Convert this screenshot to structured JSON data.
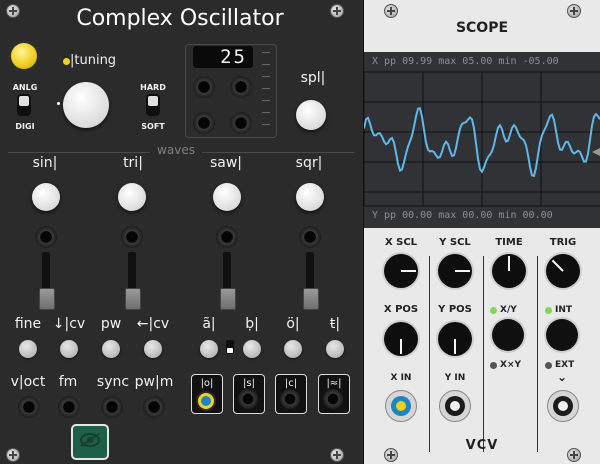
{
  "oscillator": {
    "title": "Complex Oscillator",
    "tuning_label": "|tuning",
    "anlg_label": "ANLG",
    "digi_label": "DIGI",
    "hard_label": "HARD",
    "soft_label": "SOFT",
    "display_value": "25",
    "spl_label": "spl|",
    "waves_label": "waves",
    "wave_knobs": [
      "sin|",
      "tri|",
      "saw|",
      "sqr|"
    ],
    "mod_labels": [
      "fine",
      "↓|cv",
      "pw",
      "←|cv"
    ],
    "glyph_labels": [
      "ã|",
      "ḅ|",
      "ö|",
      "ŧ|"
    ],
    "jack_labels": [
      "v|oct",
      "fm",
      "sync",
      "pw|m"
    ],
    "wave_select": [
      "|o|",
      "|s|",
      "|c|",
      "|≈|"
    ],
    "accent_color": "#f0d020"
  },
  "scope": {
    "title": "SCOPE",
    "header_line": "X   pp  09.99  max  05.00  min -05.00",
    "footer_line": "Y   pp  00.00  max  00.00  min  00.00",
    "knob_labels": [
      "X SCL",
      "Y SCL",
      "TIME",
      "TRIG"
    ],
    "pos_labels": [
      "X POS",
      "Y POS"
    ],
    "xy_label": "X/Y",
    "xxy_label": "X×Y",
    "int_label": "INT",
    "ext_label": "EXT",
    "xin_label": "X IN",
    "yin_label": "Y IN",
    "trigger_arrow": "⌄",
    "brand": "VCV",
    "trace_color": "#5fb8e8",
    "led_on_color": "#7ed957"
  }
}
